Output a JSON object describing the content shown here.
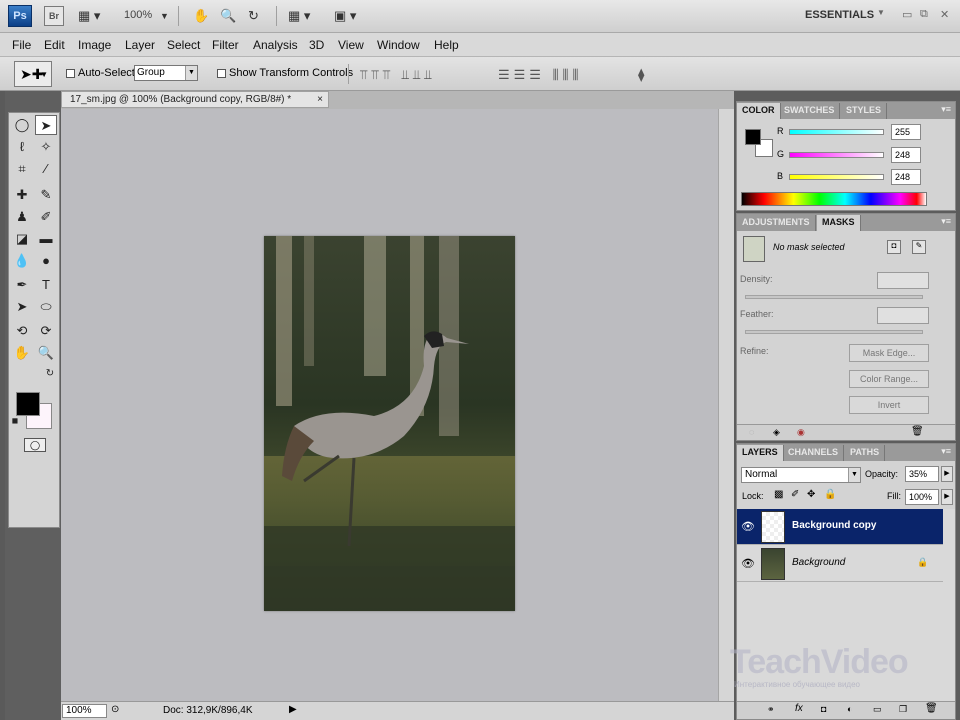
{
  "appbar": {
    "logo": "Ps",
    "bridge": "Br",
    "zoom": "100%",
    "workspace": "ESSENTIALS"
  },
  "menu": [
    "File",
    "Edit",
    "Image",
    "Layer",
    "Select",
    "Filter",
    "Analysis",
    "3D",
    "View",
    "Window",
    "Help"
  ],
  "options": {
    "auto_select_label": "Auto-Select:",
    "auto_select_value": "Group",
    "show_transform": "Show Transform Controls"
  },
  "document": {
    "tab_title": "17_sm.jpg @ 100% (Background copy, RGB/8#) *",
    "tab_close": "×",
    "zoom": "100%",
    "doc_info": "Doc: 312,9K/896,4K"
  },
  "color_panel": {
    "tabs": [
      "COLOR",
      "SWATCHES",
      "STYLES"
    ],
    "r_label": "R",
    "r_value": "255",
    "g_label": "G",
    "g_value": "248",
    "b_label": "B",
    "b_value": "248",
    "r_level": 1.0,
    "g_level": 0.97,
    "b_level": 0.97
  },
  "masks_panel": {
    "tabs": [
      "ADJUSTMENTS",
      "MASKS"
    ],
    "no_mask": "No mask selected",
    "density": "Density:",
    "feather": "Feather:",
    "refine": "Refine:",
    "mask_edge": "Mask Edge...",
    "color_range": "Color Range...",
    "invert": "Invert"
  },
  "layers_panel": {
    "tabs": [
      "LAYERS",
      "CHANNELS",
      "PATHS"
    ],
    "blend_mode": "Normal",
    "opacity_label": "Opacity:",
    "opacity_value": "35%",
    "lock_label": "Lock:",
    "fill_label": "Fill:",
    "fill_value": "100%",
    "layers": [
      {
        "name": "Background copy",
        "selected": true
      },
      {
        "name": "Background",
        "selected": false
      }
    ]
  },
  "watermark": {
    "brand": "TeachVideo",
    "tagline": "Интерактивное обучающее видео"
  },
  "colors": {
    "selected_layer": "#0a246a",
    "foreground": "#000000",
    "background": "#fdf4fb"
  }
}
